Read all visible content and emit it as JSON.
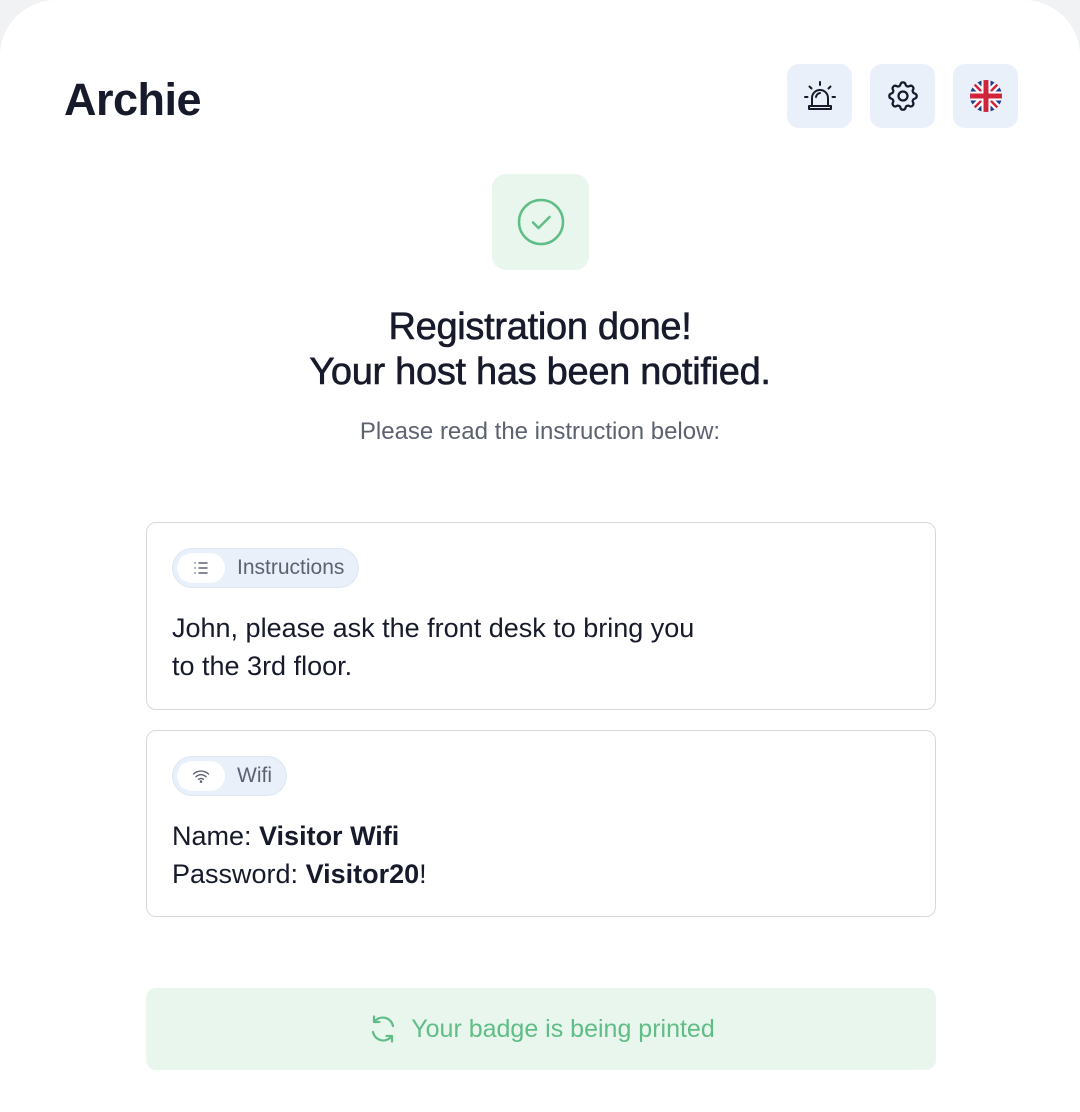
{
  "header": {
    "brand": "Archie",
    "buttons": [
      {
        "icon": "alarm-icon"
      },
      {
        "icon": "gear-icon"
      },
      {
        "icon": "uk-flag-icon"
      }
    ]
  },
  "confirmation": {
    "icon": "check-circle-icon",
    "title_line1": "Registration done!",
    "title_line2": "Your host has been notified.",
    "subtitle": "Please read the instruction below:"
  },
  "instructions_card": {
    "chip_icon": "list-icon",
    "chip_label": "Instructions",
    "line1": "John, please ask the front desk to bring you",
    "line2": "to the 3rd floor."
  },
  "wifi_card": {
    "chip_icon": "wifi-icon",
    "chip_label": "Wifi",
    "name_label": "Name: ",
    "name_value": "Visitor Wifi",
    "password_label": "Password: ",
    "password_value": "Visitor20",
    "password_suffix": "!"
  },
  "status": {
    "icon": "refresh-icon",
    "text": "Your badge is being printed"
  },
  "colors": {
    "brand_text": "#161a2b",
    "icon_button_bg": "#eaf0fa",
    "success_green": "#5fbd86",
    "success_bg": "#e9f6ee",
    "card_border": "#d7d9de"
  }
}
